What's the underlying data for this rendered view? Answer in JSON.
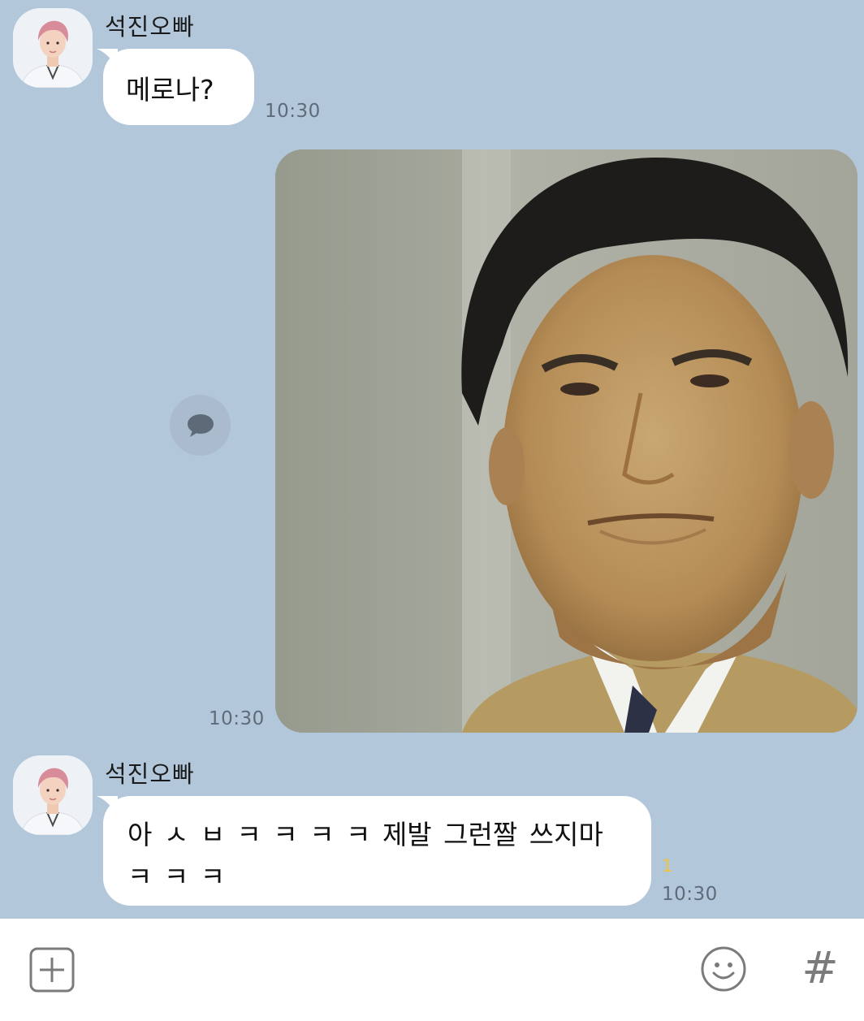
{
  "messages": [
    {
      "sender": "석진오빠",
      "text": "메로나?",
      "time": "10:30",
      "avatar_icon": "profile-photo-avatar"
    },
    {
      "type": "image",
      "time": "10:30",
      "share_icon": "speech-bubble-icon"
    },
    {
      "sender": "석진오빠",
      "text": "아 ㅅ ㅂ ㅋ ㅋ ㅋ ㅋ 제발 그런짤 쓰지마\nㅋ ㅋ ㅋ",
      "unread_count": "1",
      "time": "10:30",
      "avatar_icon": "profile-photo-avatar"
    }
  ],
  "input_bar": {
    "plus_icon": "plus-square-icon",
    "emoji_icon": "smiley-icon",
    "hash_label": "#"
  },
  "colors": {
    "chat_background": "#b3c7db",
    "bubble": "#ffffff",
    "unread": "#f2c43b",
    "time_text": "#5f6b78"
  }
}
